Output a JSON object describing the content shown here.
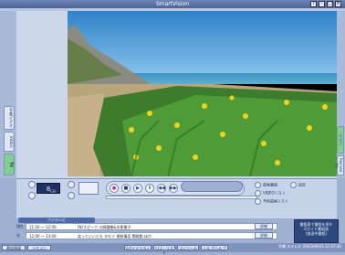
{
  "app": {
    "title": "SmartVision"
  },
  "window": {
    "buttons": [
      "?",
      "-",
      "□",
      "×"
    ]
  },
  "left_tabs": [
    "TV",
    "VIDEO",
    "写真/ビデオ"
  ],
  "right_tabs": [
    "ライブ",
    "Remote TV"
  ],
  "channel": {
    "number": "8",
    "unit": "CH"
  },
  "playback": {
    "progress": 0.0
  },
  "options": {
    "rec_list": "録画番組",
    "video_list": "VIDEOリスト",
    "schedule": "予約録画リスト",
    "settings": "設定"
  },
  "epg": {
    "header": "フジテレビ",
    "rows": [
      {
        "label": "現在",
        "time": "11:00 ～ 12:00",
        "title": "[N]スピーク 川崎健樹&木原美子",
        "detail": "詳細"
      },
      {
        "label": "次",
        "time": "12:00 ～ 13:00",
        "title": "笑っていいとも タモリ 香取慎吾 関根勤 ほか",
        "detail": "詳細"
      }
    ]
  },
  "hint": {
    "line1": "番組表で番組を探す",
    "line2": "Gガイド番組表",
    "line3": "(放送中番組)"
  },
  "bottom": {
    "left": [
      "番組情報",
      "リモコン"
    ],
    "center": [
      "Gガイドリスト",
      "ロゴ・リスト",
      "コンソール",
      "ヘルプ/ヘルプ"
    ],
    "status": "字幕 ステレオ",
    "datetime": "2003/09/03 11:07:34"
  }
}
